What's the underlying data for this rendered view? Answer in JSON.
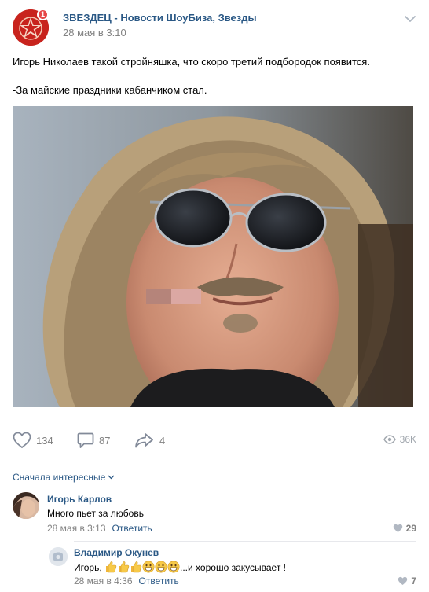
{
  "colors": {
    "link": "#2a5885",
    "meta": "#828282",
    "avatar_red": "#c8231d",
    "divider": "#e7e8ec"
  },
  "post": {
    "group_name": "ЗВЕЗДЕЦ - Новости ШоуБиза, Звезды",
    "date": "28 мая в 3:10",
    "notification_count": "1",
    "text_line1": "Игорь Николаев такой стройняшка, что скоро третий подбородок появится.",
    "text_line2": "-За майские праздники кабанчиком стал.",
    "photo_icon": "photo",
    "likes": "134",
    "comments": "87",
    "shares": "4",
    "views": "36K"
  },
  "comments_sort": "Сначала интересные",
  "comments": [
    {
      "author": "Игорь Карлов",
      "text": "Много пьет за любовь",
      "date": "28 мая в 3:13",
      "reply": "Ответить",
      "likes": "29"
    },
    {
      "author": "Владимир Окунев",
      "text_prefix": "Игорь,",
      "emojis": [
        "thumbs-up-icon",
        "thumbs-up-icon",
        "thumbs-up-icon",
        "grin-icon",
        "grin-icon",
        "grin-icon"
      ],
      "text_suffix": "...и хорошо закусывает !",
      "date": "28 мая в 4:36",
      "reply": "Ответить",
      "likes": "7"
    }
  ]
}
